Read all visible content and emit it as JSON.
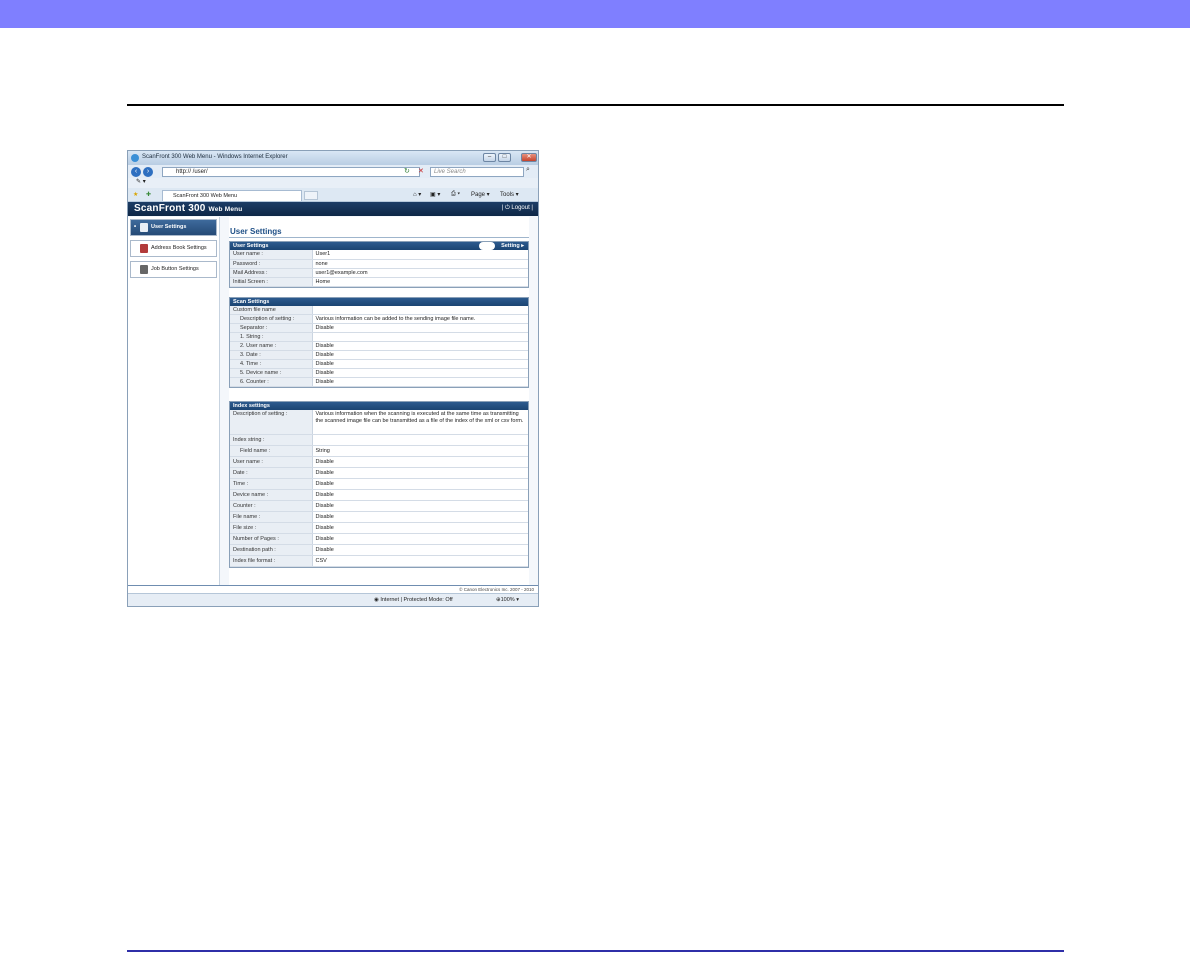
{
  "browser": {
    "window_title": "ScanFront 300 Web Menu - Windows Internet Explorer",
    "address": "http://        /user/",
    "search_placeholder": "Live Search",
    "tab_label": "ScanFront 300 Web Menu",
    "page_menu": "Page ▾",
    "tools_menu": "Tools ▾",
    "status_zone": "Internet | Protected Mode: Off",
    "zoom": "100%"
  },
  "app": {
    "logo": "ScanFront 300",
    "logo_suffix": "Web Menu",
    "logout": "Logout",
    "copyright": "© Canon Electronics Inc. 2007 - 2010"
  },
  "sidebar": {
    "items": [
      {
        "label": "User Settings"
      },
      {
        "label": "Address Book Settings"
      },
      {
        "label": "Job Button Settings"
      }
    ]
  },
  "main": {
    "title": "User Settings",
    "user_settings": {
      "header": "User Settings",
      "setting_link": "Setting ▸",
      "rows": [
        {
          "k": "User name :",
          "v": "User1"
        },
        {
          "k": "Password :",
          "v": "none"
        },
        {
          "k": "Mail Address :",
          "v": "user1@example.com"
        },
        {
          "k": "Initial Screen :",
          "v": "Home"
        }
      ]
    },
    "scan_settings": {
      "header": "Scan Settings",
      "rows": [
        {
          "k": "Custom file name",
          "v": ""
        },
        {
          "k": "Description of setting :",
          "v": "Various information can be added to the sending image file name."
        },
        {
          "k": "Separator :",
          "v": "Disable"
        },
        {
          "k": "1. String :",
          "v": ""
        },
        {
          "k": "2. User name :",
          "v": "Disable"
        },
        {
          "k": "3. Date :",
          "v": "Disable"
        },
        {
          "k": "4. Time :",
          "v": "Disable"
        },
        {
          "k": "5. Device name :",
          "v": "Disable"
        },
        {
          "k": "6. Counter :",
          "v": "Disable"
        }
      ]
    },
    "index_settings": {
      "header": "Index settings",
      "description_key": "Description of setting :",
      "description_value": "Various information when the scanning is executed at the same time as transmitting the scanned image file can be transmitted as a file of the index of the xml or csv form.",
      "rows": [
        {
          "k": "Index string :",
          "v": ""
        },
        {
          "k": "Field name :",
          "v": "String"
        },
        {
          "k": "User name :",
          "v": "Disable"
        },
        {
          "k": "Date :",
          "v": "Disable"
        },
        {
          "k": "Time :",
          "v": "Disable"
        },
        {
          "k": "Device name :",
          "v": "Disable"
        },
        {
          "k": "Counter :",
          "v": "Disable"
        },
        {
          "k": "File name :",
          "v": "Disable"
        },
        {
          "k": "File size :",
          "v": "Disable"
        },
        {
          "k": "Number of Pages :",
          "v": "Disable"
        },
        {
          "k": "Destination path :",
          "v": "Disable"
        },
        {
          "k": "Index file format :",
          "v": "CSV"
        }
      ]
    }
  }
}
